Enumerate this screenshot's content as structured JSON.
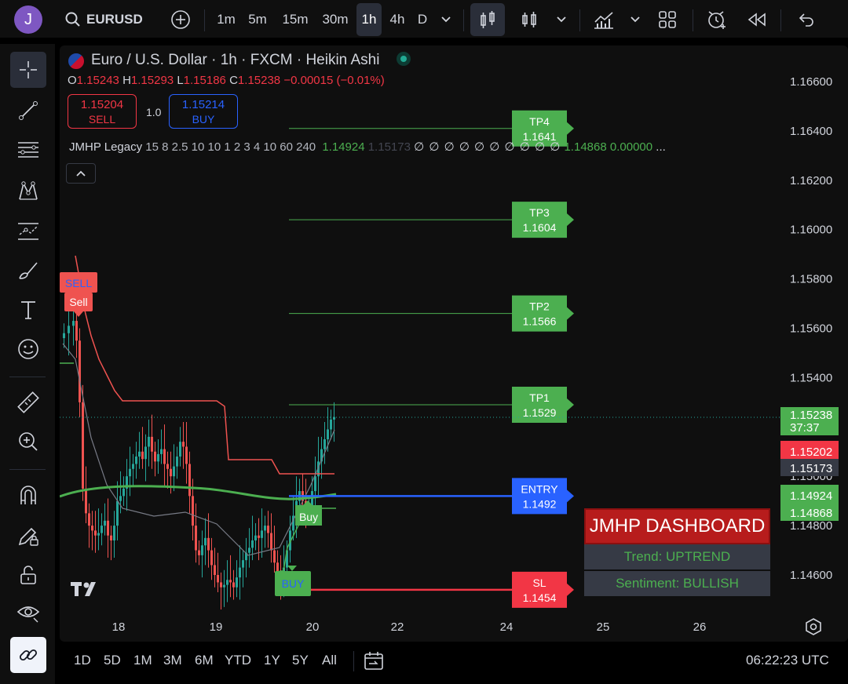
{
  "user": {
    "avatar_letter": "J"
  },
  "topbar": {
    "symbol": "EURUSD",
    "intervals": [
      "1m",
      "5m",
      "15m",
      "30m",
      "1h",
      "4h",
      "D"
    ],
    "active_interval": "1h"
  },
  "header": {
    "title": "Euro / U.S. Dollar · 1h · FXCM · Heikin Ashi",
    "ohlc": {
      "o_label": "O",
      "o": "1.15243",
      "h_label": "H",
      "h": "1.15293",
      "l_label": "L",
      "l": "1.15186",
      "c_label": "C",
      "c": "1.15238",
      "change": "−0.00015 (−0.01%)"
    },
    "sell_price": "1.15204",
    "sell_label": "SELL",
    "spread": "1.0",
    "buy_price": "1.15214",
    "buy_label": "BUY"
  },
  "indicator": {
    "name": "JMHP Legacy",
    "params": "15 8 2.5 10 10 1 2 3 4 10 60 240",
    "v1": "1.14924",
    "v2": "1.15173",
    "empties": "∅ ∅ ∅ ∅ ∅ ∅ ∅ ∅ ∅ ∅",
    "v3": "1.14868",
    "v4": "0.00000",
    "more": "..."
  },
  "levels": [
    {
      "label": "TP4",
      "value": "1.1641",
      "color": "#4caf50"
    },
    {
      "label": "TP3",
      "value": "1.1604",
      "color": "#4caf50"
    },
    {
      "label": "TP2",
      "value": "1.1566",
      "color": "#4caf50"
    },
    {
      "label": "TP1",
      "value": "1.1529",
      "color": "#4caf50"
    },
    {
      "label": "ENTRY",
      "value": "1.1492",
      "color": "#2962ff"
    },
    {
      "label": "SL",
      "value": "1.1454",
      "color": "#f23645"
    }
  ],
  "price_axis": [
    "1.16600",
    "1.16400",
    "1.16200",
    "1.16000",
    "1.15800",
    "1.15600",
    "1.15400",
    "1.15000",
    "1.14800",
    "1.14600"
  ],
  "price_badges": [
    {
      "text": "1.15238",
      "color": "#4caf50"
    },
    {
      "text": "37:37",
      "color": "#4caf50"
    },
    {
      "text": "1.15202",
      "color": "#f23645"
    },
    {
      "text": "1.15173",
      "color": "#363a45"
    },
    {
      "text": "1.14924",
      "color": "#4caf50"
    },
    {
      "text": "1.14868",
      "color": "#4caf50"
    }
  ],
  "time_axis": [
    "18",
    "19",
    "20",
    "22",
    "24",
    "25",
    "26"
  ],
  "signals": {
    "sell_top": "SELL",
    "sell_bottom": "Sell",
    "buy_top": "Buy",
    "buy_bottom": "BUY"
  },
  "dashboard": {
    "title": "JMHP DASHBOARD",
    "trend": "Trend: UPTREND",
    "sentiment": "Sentiment: BULLISH"
  },
  "bottombar": {
    "ranges": [
      "1D",
      "5D",
      "1M",
      "3M",
      "6M",
      "YTD",
      "1Y",
      "5Y",
      "All"
    ],
    "clock": "06:22:23 UTC"
  },
  "colors": {
    "up": "#26a69a",
    "down": "#ef5350",
    "green": "#4caf50",
    "blue": "#2962ff",
    "red": "#f23645",
    "background": "#0f0f0f"
  }
}
